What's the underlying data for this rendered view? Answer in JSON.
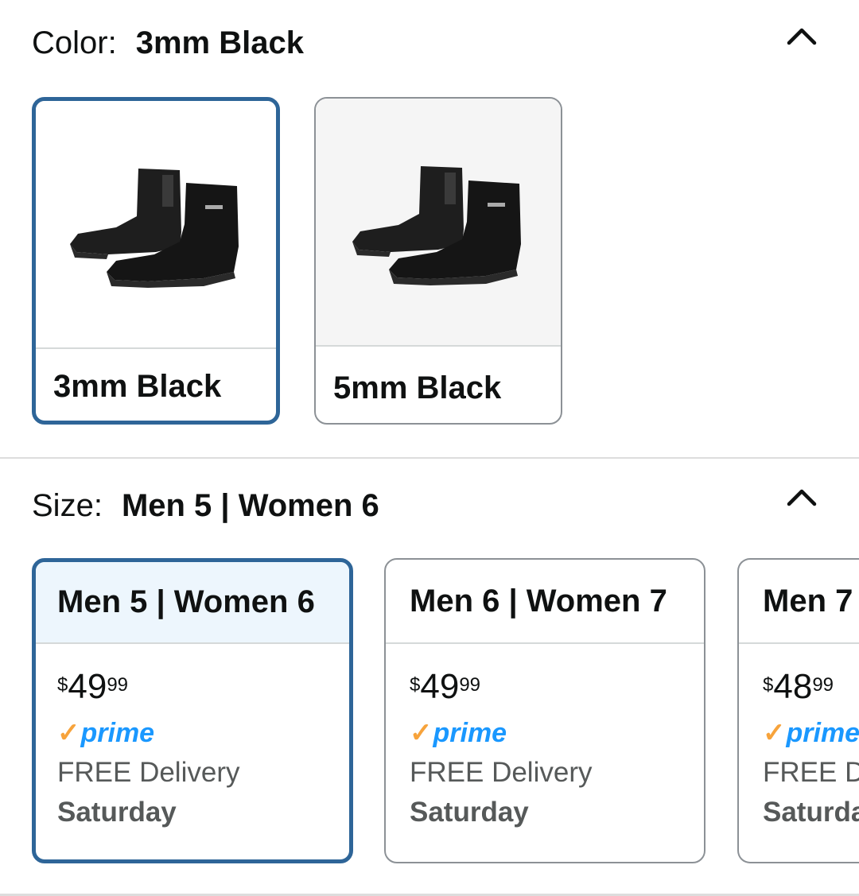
{
  "color": {
    "label": "Color:",
    "selected": "3mm Black",
    "options": [
      {
        "label": "3mm Black"
      },
      {
        "label": "5mm Black"
      }
    ]
  },
  "size": {
    "label": "Size:",
    "selected": "Men 5 | Women 6",
    "options": [
      {
        "label": "Men 5 | Women 6",
        "price_dollars": "49",
        "price_cents": "99",
        "currency": "$",
        "prime": "prime",
        "delivery": "FREE Delivery",
        "day": "Saturday"
      },
      {
        "label": "Men 6 | Women 7",
        "price_dollars": "49",
        "price_cents": "99",
        "currency": "$",
        "prime": "prime",
        "delivery": "FREE Delivery",
        "day": "Saturday"
      },
      {
        "label": "Men 7",
        "price_dollars": "48",
        "price_cents": "99",
        "currency": "$",
        "prime": "prime",
        "delivery": "FREE De",
        "day": "Saturda"
      }
    ]
  },
  "icons": {
    "collapse": "chevron-up-icon",
    "prime_check": "check-icon"
  },
  "colors": {
    "selected_border": "#2e6598",
    "selected_head_bg": "#edf6fd",
    "prime_blue": "#1a98ff",
    "prime_check": "#f7a33b"
  }
}
